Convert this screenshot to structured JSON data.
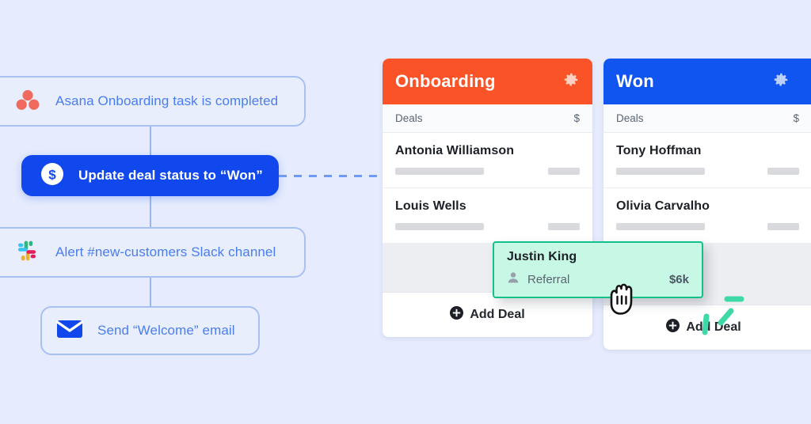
{
  "theme": {
    "background": "#e6ecfd",
    "accent_blue": "#1148ee",
    "link_blue": "#4a7df0",
    "onboarding_header": "#fb5328",
    "won_header": "#1155f0",
    "drag_card_fill": "#c7f7e5",
    "drag_card_border": "#14c08a",
    "motion_line": "#3fd9a8"
  },
  "workflow": {
    "steps": [
      {
        "id": "trigger-asana",
        "icon": "asana-icon",
        "label": "Asana Onboarding task is completed",
        "style": "outline"
      },
      {
        "id": "action-deal-status",
        "icon": "dollar-circle-icon",
        "label": "Update deal status to “Won”",
        "style": "primary"
      },
      {
        "id": "action-slack-alert",
        "icon": "slack-icon",
        "label": "Alert #new-customers Slack channel",
        "style": "outline"
      },
      {
        "id": "action-welcome-email",
        "icon": "envelope-icon",
        "label": "Send “Welcome” email",
        "style": "outline"
      }
    ]
  },
  "boards": [
    {
      "id": "onboarding",
      "title": "Onboarding",
      "header_color": "#fb5328",
      "settings_icon": "gear-icon",
      "columns": {
        "name": "Deals",
        "amount": "$"
      },
      "deals": [
        {
          "name": "Antonia Williamson"
        },
        {
          "name": "Louis Wells"
        }
      ],
      "has_drop_slot": true,
      "add_label": "Add Deal",
      "add_icon": "plus-circle-icon"
    },
    {
      "id": "won",
      "title": "Won",
      "header_color": "#1155f0",
      "settings_icon": "gear-icon",
      "columns": {
        "name": "Deals",
        "amount": "$"
      },
      "deals": [
        {
          "name": "Tony Hoffman"
        },
        {
          "name": "Olivia Carvalho"
        }
      ],
      "has_drop_slot": true,
      "add_label": "Add Deal",
      "add_icon": "plus-circle-icon"
    }
  ],
  "drag_card": {
    "name": "Justin King",
    "source_icon": "person-icon",
    "source": "Referral",
    "amount": "$6k",
    "cursor": "grabbing-hand-cursor"
  }
}
